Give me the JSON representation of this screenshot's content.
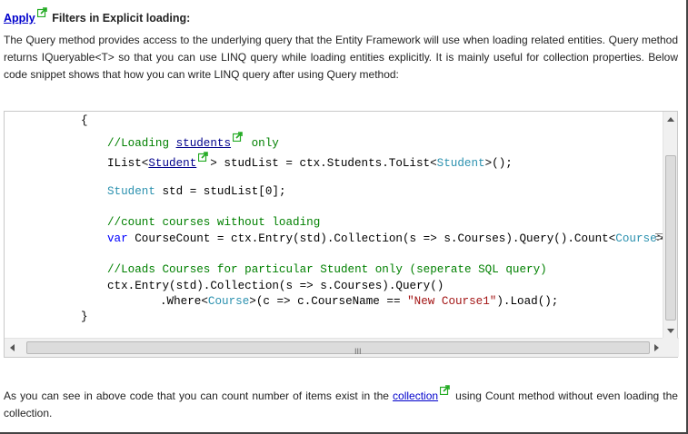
{
  "heading": {
    "link_text": "Apply",
    "title": "Filters in Explicit loading:"
  },
  "intro_text": "The Query method provides access to the underlying query that the Entity Framework will use when loading related entities. Query method returns IQueryable<T> so that you can use LINQ query while loading entities explicitly. It is mainly useful for collection properties. Below code snippet shows that how you can write LINQ query after using Query method:",
  "code": {
    "line1": "{",
    "line2_comment_a": "//Loading ",
    "line2_link": "students",
    "line2_comment_b": " only",
    "line3_a": "IList<",
    "line3_link": "Student",
    "line3_b": "> studList = ctx.Students.ToList<",
    "line3_type": "Student",
    "line3_c": ">();",
    "line4_type": "Student",
    "line4_rest": " std = studList[0];",
    "line5_comment": "//count courses without loading",
    "line6_kw": "var",
    "line6_a": " CourseCount = ctx.Entry(std).Collection(s => s.Courses).Query().Count<",
    "line6_type": "Course",
    "line6_b": ">();",
    "line7_comment": "//Loads Courses for particular Student only (seperate SQL query)",
    "line8": "ctx.Entry(std).Collection(s => s.Courses).Query()",
    "line9_a": ".Where<",
    "line9_type": "Course",
    "line9_b": ">(c => c.CourseName == ",
    "line9_string": "\"New Course1\"",
    "line9_c": ").Load();",
    "line10": "}"
  },
  "outro": {
    "text_a": "As you can see in above code that you can count number of items exist in the ",
    "link_text": "collection",
    "text_b": " using Count method without even loading the collection."
  },
  "scrollbar_grip": "III",
  "colors": {
    "link": "#0000cc",
    "comment": "#008000",
    "keyword": "#0000ff",
    "type": "#2b91af",
    "string": "#a31515",
    "external_icon": "#22aa22"
  },
  "icons": [
    "external-link-icon",
    "scroll-up-icon",
    "scroll-down-icon",
    "scroll-left-icon",
    "scroll-right-icon"
  ]
}
